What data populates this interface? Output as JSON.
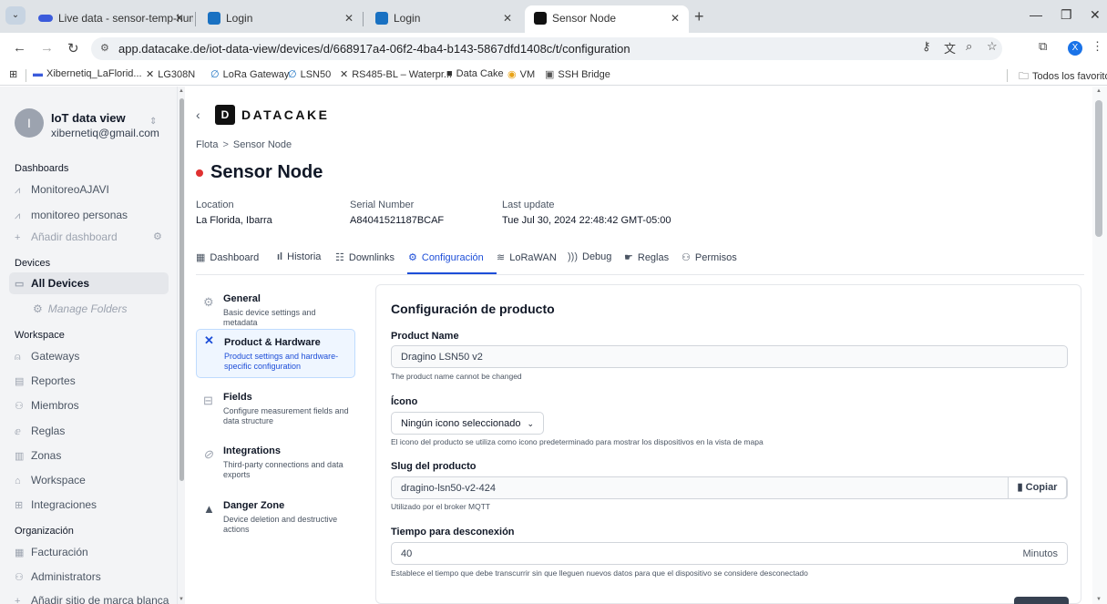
{
  "browser": {
    "tabs": [
      {
        "title": "Live data - sensor-temp-humed",
        "active": false
      },
      {
        "title": "Login",
        "active": false
      },
      {
        "title": "Login",
        "active": false
      },
      {
        "title": "Sensor Node",
        "active": true
      }
    ],
    "url": "app.datacake.de/iot-data-view/devices/d/668917a4-06f2-4ba4-b143-5867dfd1408c/t/configuration",
    "profile_initial": "X",
    "bookmarks": [
      "Xibernetiq_LaFlorid...",
      "LG308N",
      "LoRa Gateway",
      "LSN50",
      "RS485-BL – Waterpr...",
      "Data Cake",
      "VM",
      "SSH Bridge"
    ],
    "all_bookmarks": "Todos los favoritos"
  },
  "sidebar": {
    "account": {
      "initial": "I",
      "name": "IoT data view",
      "email": "xibernetiq@gmail.com"
    },
    "dashboards_heading": "Dashboards",
    "dashboards": [
      "MonitoreoAJAVI",
      "monitoreo personas"
    ],
    "add_dashboard": "Añadir dashboard",
    "devices_heading": "Devices",
    "all_devices": "All Devices",
    "manage_folders": "Manage Folders",
    "workspace_heading": "Workspace",
    "workspace_items": [
      "Gateways",
      "Reportes",
      "Miembros",
      "Reglas",
      "Zonas",
      "Workspace",
      "Integraciones"
    ],
    "org_heading": "Organización",
    "org_items": [
      "Facturación",
      "Administrators",
      "Añadir sitio de marca blanca"
    ]
  },
  "header": {
    "logo": "DATACAKE",
    "breadcrumb": [
      "Flota",
      "Sensor Node"
    ],
    "title": "Sensor Node",
    "status_color": "#e03131",
    "meta": [
      {
        "label": "Location",
        "value": "La Florida, Ibarra"
      },
      {
        "label": "Serial Number",
        "value": "A84041521187BCAF"
      },
      {
        "label": "Last update",
        "value": "Tue Jul 30, 2024 22:48:42 GMT-05:00"
      }
    ]
  },
  "tabs": [
    {
      "label": "Dashboard",
      "icon": "table-icon"
    },
    {
      "label": "Historia",
      "icon": "bars-icon"
    },
    {
      "label": "Downlinks",
      "icon": "sliders-icon"
    },
    {
      "label": "Configuración",
      "icon": "gear-icon",
      "active": true
    },
    {
      "label": "LoRaWAN",
      "icon": "wifi-icon"
    },
    {
      "label": "Debug",
      "icon": "signal-icon"
    },
    {
      "label": "Reglas",
      "icon": "rules-icon"
    },
    {
      "label": "Permisos",
      "icon": "users-icon"
    }
  ],
  "settings_nav": [
    {
      "title": "General",
      "desc": "Basic device settings and metadata",
      "icon": "gear-icon"
    },
    {
      "title": "Product & Hardware",
      "desc": "Product settings and hardware-specific configuration",
      "icon": "tools-icon",
      "active": true
    },
    {
      "title": "Fields",
      "desc": "Configure measurement fields and data structure",
      "icon": "fields-icon"
    },
    {
      "title": "Integrations",
      "desc": "Third-party connections and data exports",
      "icon": "link-icon"
    },
    {
      "title": "Danger Zone",
      "desc": "Device deletion and destructive actions",
      "icon": "warning-icon"
    }
  ],
  "product_config": {
    "heading": "Configuración de producto",
    "product_name_label": "Product Name",
    "product_name_value": "Dragino LSN50 v2",
    "product_name_help": "The product name cannot be changed",
    "icon_label": "Ícono",
    "icon_value": "Ningún icono seleccionado",
    "icon_help": "El icono del producto se utiliza como icono predeterminado para mostrar los dispositivos en la vista de mapa",
    "slug_label": "Slug del producto",
    "slug_value": "dragino-lsn50-v2-424",
    "copy_label": "Copiar",
    "slug_help": "Utilizado por el broker MQTT",
    "timeout_label": "Tiempo para desconexión",
    "timeout_value": "40",
    "timeout_unit": "Minutos",
    "timeout_help": "Establece el tiempo que debe transcurrir sin que lleguen nuevos datos para que el dispositivo se considere desconectado"
  }
}
